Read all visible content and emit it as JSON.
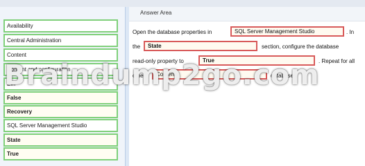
{
  "answer_area": {
    "title": "Answer Area",
    "sentence_1": "Open the database properties in",
    "sentence_1_end": ". In",
    "sentence_2": "the",
    "sentence_2_end": "section, configure the database",
    "sentence_3": "read-only property to",
    "sentence_3_end": ". Repeat for all",
    "sentence_4": "other",
    "sentence_4_end": "databases.",
    "drop_1": "SQL Server Management Studio",
    "drop_2": "State",
    "drop_3": "True",
    "drop_4": "Content"
  },
  "options": [
    {
      "label": "Availability",
      "bold": false
    },
    {
      "label": "Central Administration",
      "bold": false
    },
    {
      "label": "Content",
      "bold": false
    },
    {
      "label": "Content and configuration",
      "bold": false
    },
    {
      "label": "Em",
      "bold": false
    },
    {
      "label": "False",
      "bold": true
    },
    {
      "label": "Recovery",
      "bold": true
    },
    {
      "label": "SQL Server Management Studio",
      "bold": false
    },
    {
      "label": "State",
      "bold": true
    },
    {
      "label": "True",
      "bold": true
    }
  ],
  "watermark": "Braindump2go.com"
}
